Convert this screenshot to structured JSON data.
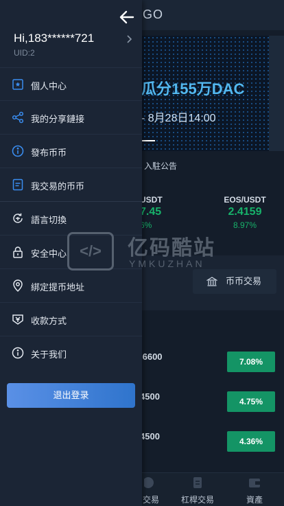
{
  "background": {
    "logo_fragment": "GO",
    "banner": {
      "title": "瓜分155万DAC",
      "date": "- 8月28日14:00"
    },
    "notice": "入駐公告",
    "tickers": [
      {
        "pair": "USDT",
        "price": "7.45",
        "pct": "6%"
      },
      {
        "pair": "EOS/USDT",
        "price": "2.4159",
        "pct": "8.97%"
      }
    ],
    "trade_button": "币币交易",
    "market_rows": [
      {
        "value": ".6600",
        "change": "7.08%"
      },
      {
        "value": "4500",
        "change": "4.75%"
      },
      {
        "value": "4500",
        "change": "4.36%"
      }
    ],
    "tabs": [
      {
        "label": "交易",
        "icon": "trade-icon"
      },
      {
        "label": "杠桿交易",
        "icon": "leverage-icon"
      },
      {
        "label": "資產",
        "icon": "wallet-icon"
      }
    ]
  },
  "watermark": {
    "cn": "亿码酷站",
    "en": "YMKUZHAN",
    "symbol": "</>"
  },
  "drawer": {
    "greeting": "Hi,183******721",
    "uid": "UID:2",
    "menu": [
      {
        "label": "個人中心",
        "icon": "user-card-icon"
      },
      {
        "label": "我的分享鏈接",
        "icon": "share-icon"
      },
      {
        "label": "發布币币",
        "icon": "info-icon"
      },
      {
        "label": "我交易的币币",
        "icon": "document-icon"
      },
      {
        "label": "語言切換",
        "icon": "language-icon"
      },
      {
        "label": "安全中心",
        "icon": "lock-icon"
      },
      {
        "label": "綁定提币地址",
        "icon": "location-icon"
      },
      {
        "label": "收款方式",
        "icon": "payment-icon"
      },
      {
        "label": "关于我们",
        "icon": "about-icon"
      }
    ],
    "logout": "退出登录"
  },
  "colors": {
    "accent": "#3a82e0",
    "up": "#149465",
    "drawer_bg": "#1b2535"
  }
}
